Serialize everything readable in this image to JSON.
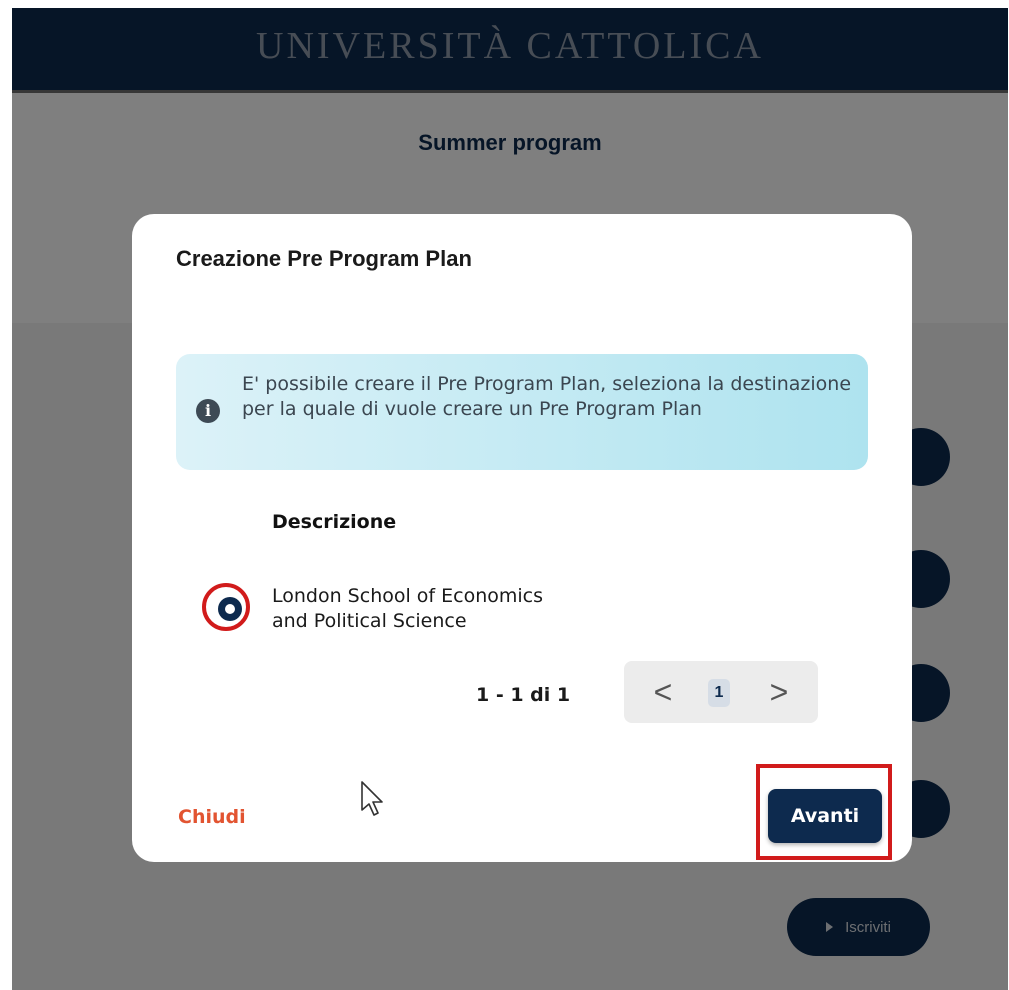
{
  "header": {
    "logo_text": "UNIVERSITÀ CATTOLICA"
  },
  "page": {
    "title": "Summer program",
    "enroll_label": "Iscriviti"
  },
  "modal": {
    "title": "Creazione Pre Program Plan",
    "info": "E' possibile creare il Pre Program Plan, seleziona la destinazione per la quale di vuole creare un Pre Program Plan",
    "column_header": "Descrizione",
    "rows": [
      {
        "description_line1": "London School of Economics",
        "description_line2": "and Political Science",
        "selected": true
      }
    ],
    "pagination": {
      "summary": "1 - 1 di 1",
      "current_page": "1",
      "prev_glyph": "<",
      "next_glyph": ">"
    },
    "close_label": "Chiudi",
    "next_label": "Avanti"
  },
  "colors": {
    "navy": "#0d2a4e",
    "highlight": "#d11b1b",
    "close": "#e25431"
  },
  "icons": [
    "info-icon",
    "chevron-left-icon",
    "chevron-right-icon",
    "play-icon",
    "mouse-pointer-icon"
  ]
}
